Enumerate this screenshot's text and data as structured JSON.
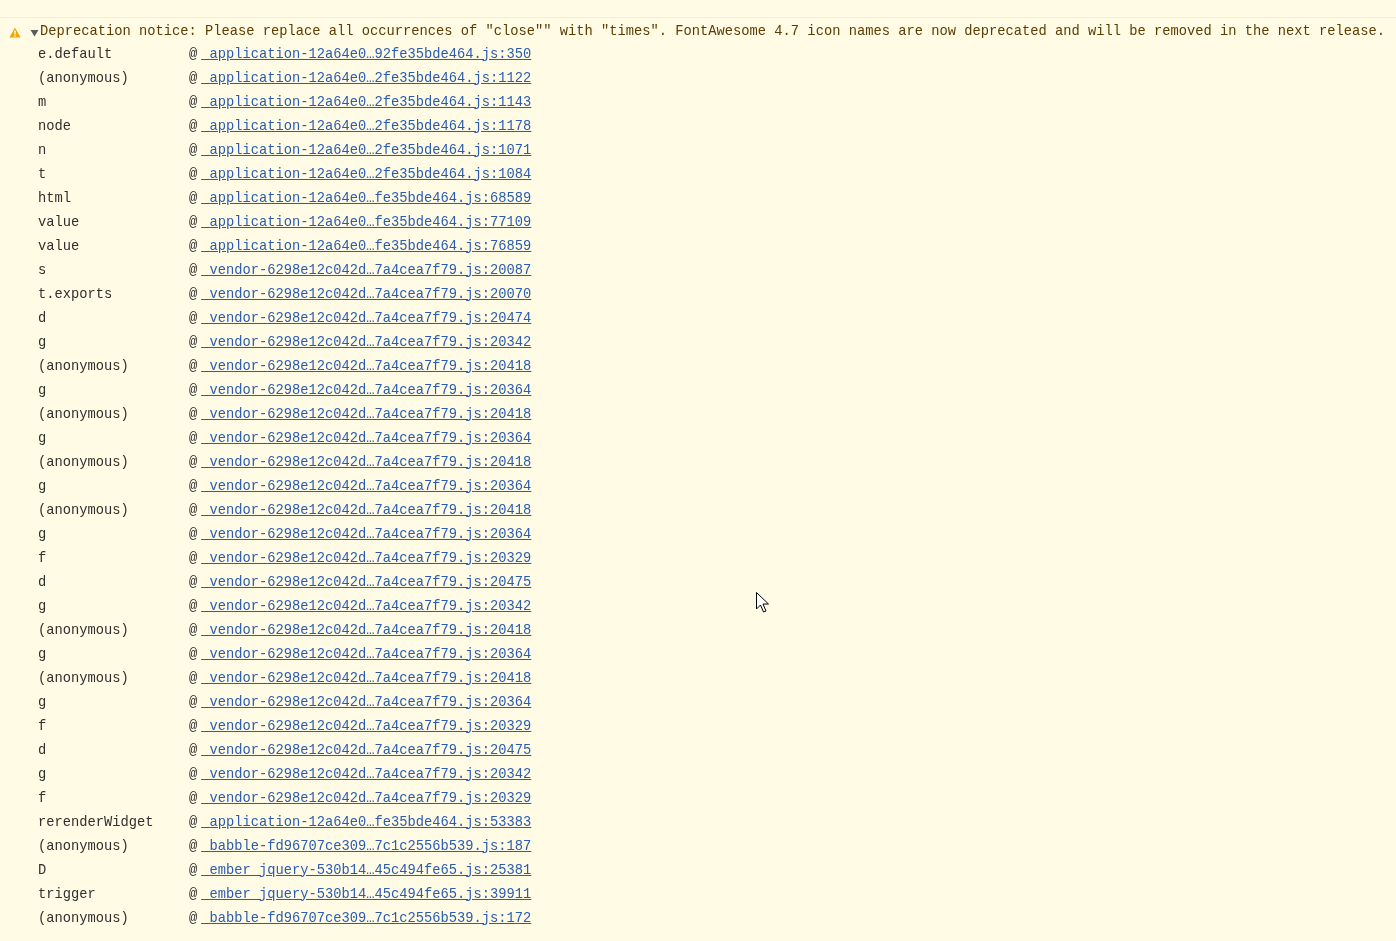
{
  "warning": {
    "expanded": true,
    "message": "Deprecation notice: Please replace all occurrences of \"close\"\" with \"times\". FontAwesome 4.7 icon names are now deprecated and will be removed in the next release.",
    "stack": [
      {
        "function": "e.default",
        "at": "@",
        "source": "_application-12a64e0…92fe35bde464.js:350"
      },
      {
        "function": "(anonymous)",
        "at": "@",
        "source": "_application-12a64e0…2fe35bde464.js:1122"
      },
      {
        "function": "m",
        "at": "@",
        "source": "_application-12a64e0…2fe35bde464.js:1143"
      },
      {
        "function": "node",
        "at": "@",
        "source": "_application-12a64e0…2fe35bde464.js:1178"
      },
      {
        "function": "n",
        "at": "@",
        "source": "_application-12a64e0…2fe35bde464.js:1071"
      },
      {
        "function": "t",
        "at": "@",
        "source": "_application-12a64e0…2fe35bde464.js:1084"
      },
      {
        "function": "html",
        "at": "@",
        "source": "_application-12a64e0…fe35bde464.js:68589"
      },
      {
        "function": "value",
        "at": "@",
        "source": "_application-12a64e0…fe35bde464.js:77109"
      },
      {
        "function": "value",
        "at": "@",
        "source": "_application-12a64e0…fe35bde464.js:76859"
      },
      {
        "function": "s",
        "at": "@",
        "source": "_vendor-6298e12c042d…7a4cea7f79.js:20087"
      },
      {
        "function": "t.exports",
        "at": "@",
        "source": "_vendor-6298e12c042d…7a4cea7f79.js:20070"
      },
      {
        "function": "d",
        "at": "@",
        "source": "_vendor-6298e12c042d…7a4cea7f79.js:20474"
      },
      {
        "function": "g",
        "at": "@",
        "source": "_vendor-6298e12c042d…7a4cea7f79.js:20342"
      },
      {
        "function": "(anonymous)",
        "at": "@",
        "source": "_vendor-6298e12c042d…7a4cea7f79.js:20418"
      },
      {
        "function": "g",
        "at": "@",
        "source": "_vendor-6298e12c042d…7a4cea7f79.js:20364"
      },
      {
        "function": "(anonymous)",
        "at": "@",
        "source": "_vendor-6298e12c042d…7a4cea7f79.js:20418"
      },
      {
        "function": "g",
        "at": "@",
        "source": "_vendor-6298e12c042d…7a4cea7f79.js:20364"
      },
      {
        "function": "(anonymous)",
        "at": "@",
        "source": "_vendor-6298e12c042d…7a4cea7f79.js:20418"
      },
      {
        "function": "g",
        "at": "@",
        "source": "_vendor-6298e12c042d…7a4cea7f79.js:20364"
      },
      {
        "function": "(anonymous)",
        "at": "@",
        "source": "_vendor-6298e12c042d…7a4cea7f79.js:20418"
      },
      {
        "function": "g",
        "at": "@",
        "source": "_vendor-6298e12c042d…7a4cea7f79.js:20364"
      },
      {
        "function": "f",
        "at": "@",
        "source": "_vendor-6298e12c042d…7a4cea7f79.js:20329"
      },
      {
        "function": "d",
        "at": "@",
        "source": "_vendor-6298e12c042d…7a4cea7f79.js:20475"
      },
      {
        "function": "g",
        "at": "@",
        "source": "_vendor-6298e12c042d…7a4cea7f79.js:20342"
      },
      {
        "function": "(anonymous)",
        "at": "@",
        "source": "_vendor-6298e12c042d…7a4cea7f79.js:20418"
      },
      {
        "function": "g",
        "at": "@",
        "source": "_vendor-6298e12c042d…7a4cea7f79.js:20364"
      },
      {
        "function": "(anonymous)",
        "at": "@",
        "source": "_vendor-6298e12c042d…7a4cea7f79.js:20418"
      },
      {
        "function": "g",
        "at": "@",
        "source": "_vendor-6298e12c042d…7a4cea7f79.js:20364"
      },
      {
        "function": "f",
        "at": "@",
        "source": "_vendor-6298e12c042d…7a4cea7f79.js:20329"
      },
      {
        "function": "d",
        "at": "@",
        "source": "_vendor-6298e12c042d…7a4cea7f79.js:20475"
      },
      {
        "function": "g",
        "at": "@",
        "source": "_vendor-6298e12c042d…7a4cea7f79.js:20342"
      },
      {
        "function": "f",
        "at": "@",
        "source": "_vendor-6298e12c042d…7a4cea7f79.js:20329"
      },
      {
        "function": "rerenderWidget",
        "at": "@",
        "source": "_application-12a64e0…fe35bde464.js:53383"
      },
      {
        "function": "(anonymous)",
        "at": "@",
        "source": "_babble-fd96707ce309…7c1c2556b539.js:187"
      },
      {
        "function": "D",
        "at": "@",
        "source": "_ember_jquery-530b14…45c494fe65.js:25381"
      },
      {
        "function": "trigger",
        "at": "@",
        "source": "_ember_jquery-530b14…45c494fe65.js:39911"
      },
      {
        "function": "(anonymous)",
        "at": "@",
        "source": "_babble-fd96707ce309…7c1c2556b539.js:172"
      }
    ]
  }
}
